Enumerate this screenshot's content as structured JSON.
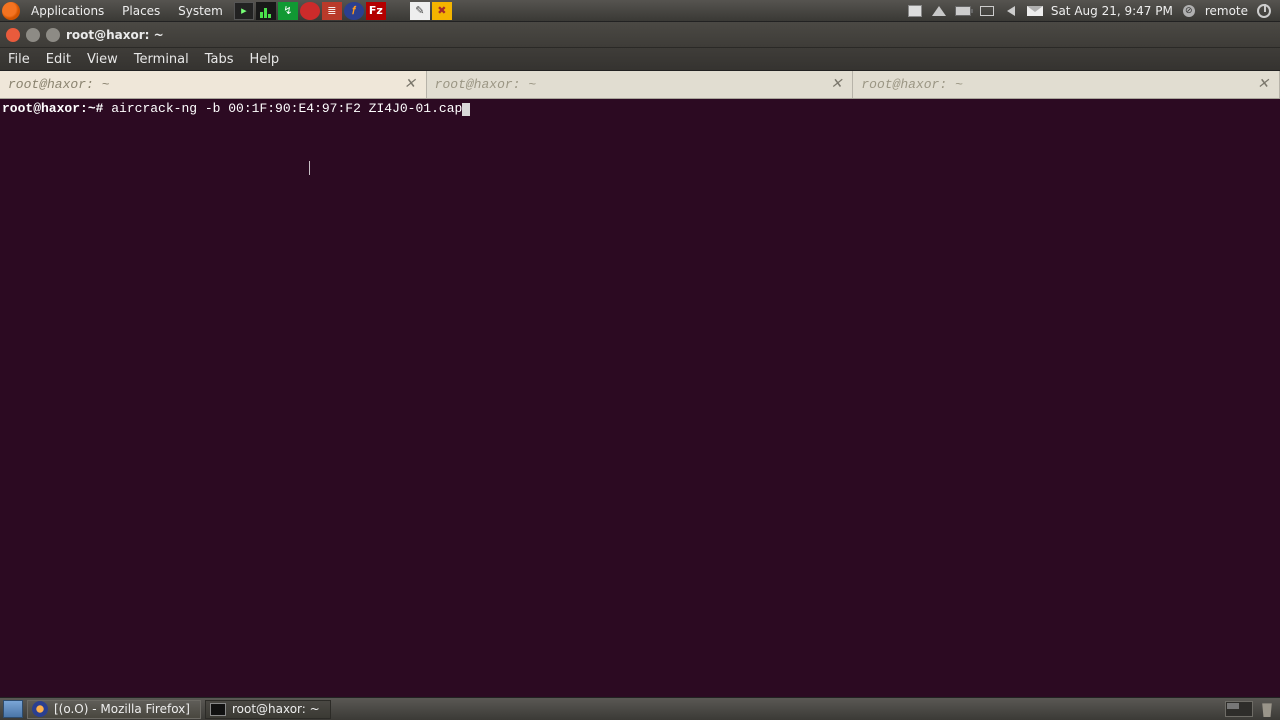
{
  "top_panel": {
    "menus": {
      "applications": "Applications",
      "places": "Places",
      "system": "System"
    },
    "clock": "Sat Aug 21,  9:47 PM",
    "user": "remote"
  },
  "window": {
    "title": "root@haxor: ~"
  },
  "menubar": {
    "file": "File",
    "edit": "Edit",
    "view": "View",
    "terminal": "Terminal",
    "tabs": "Tabs",
    "help": "Help"
  },
  "tabs": [
    {
      "label": "root@haxor: ~",
      "active": true
    },
    {
      "label": "root@haxor: ~",
      "active": false
    },
    {
      "label": "root@haxor: ~",
      "active": false
    }
  ],
  "terminal": {
    "prompt_host": "root@haxor",
    "prompt_sep": ":~#",
    "command": "aircrack-ng -b 00:1F:90:E4:97:F2 ZI4J0-01.cap"
  },
  "taskbar": {
    "tasks": [
      {
        "label": "[(o.O) - Mozilla Firefox]"
      },
      {
        "label": "root@haxor: ~"
      }
    ]
  }
}
